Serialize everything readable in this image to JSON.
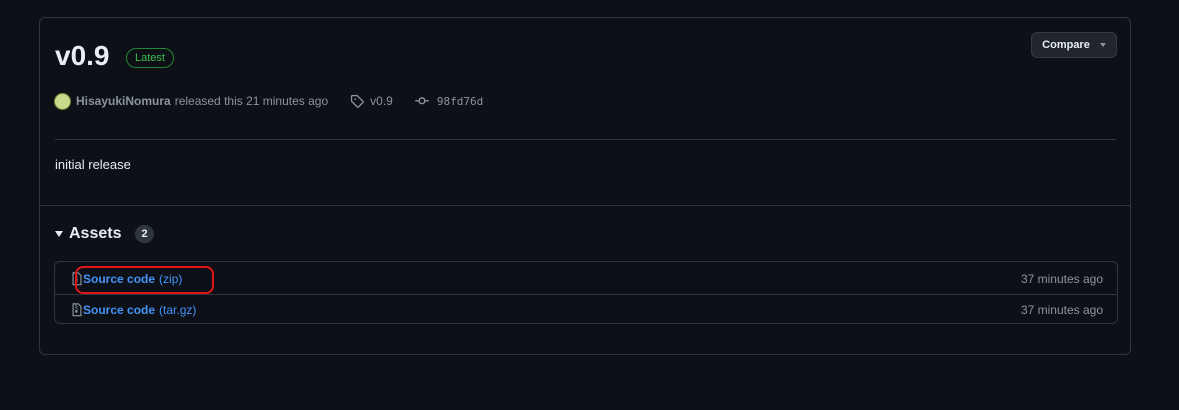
{
  "release": {
    "title": "v0.9",
    "latest_badge": "Latest",
    "compare_label": "Compare",
    "author": "HisayukiNomura",
    "released_text": "released this 21 minutes ago",
    "tag": "v0.9",
    "commit": "98fd76d",
    "body": "initial release"
  },
  "assets": {
    "title": "Assets",
    "count": "2",
    "items": [
      {
        "name": "Source code",
        "ext": "(zip)",
        "time": "37 minutes ago"
      },
      {
        "name": "Source code",
        "ext": "(tar.gz)",
        "time": "37 minutes ago"
      }
    ]
  },
  "colors": {
    "background": "#0d1117",
    "link": "#4493f8",
    "latest": "#3fb950",
    "highlight": "#e0161b"
  },
  "icons": [
    "avatar",
    "tag-icon",
    "commit-icon",
    "file-zip-icon",
    "caret-down-icon",
    "triangle-down-icon"
  ]
}
